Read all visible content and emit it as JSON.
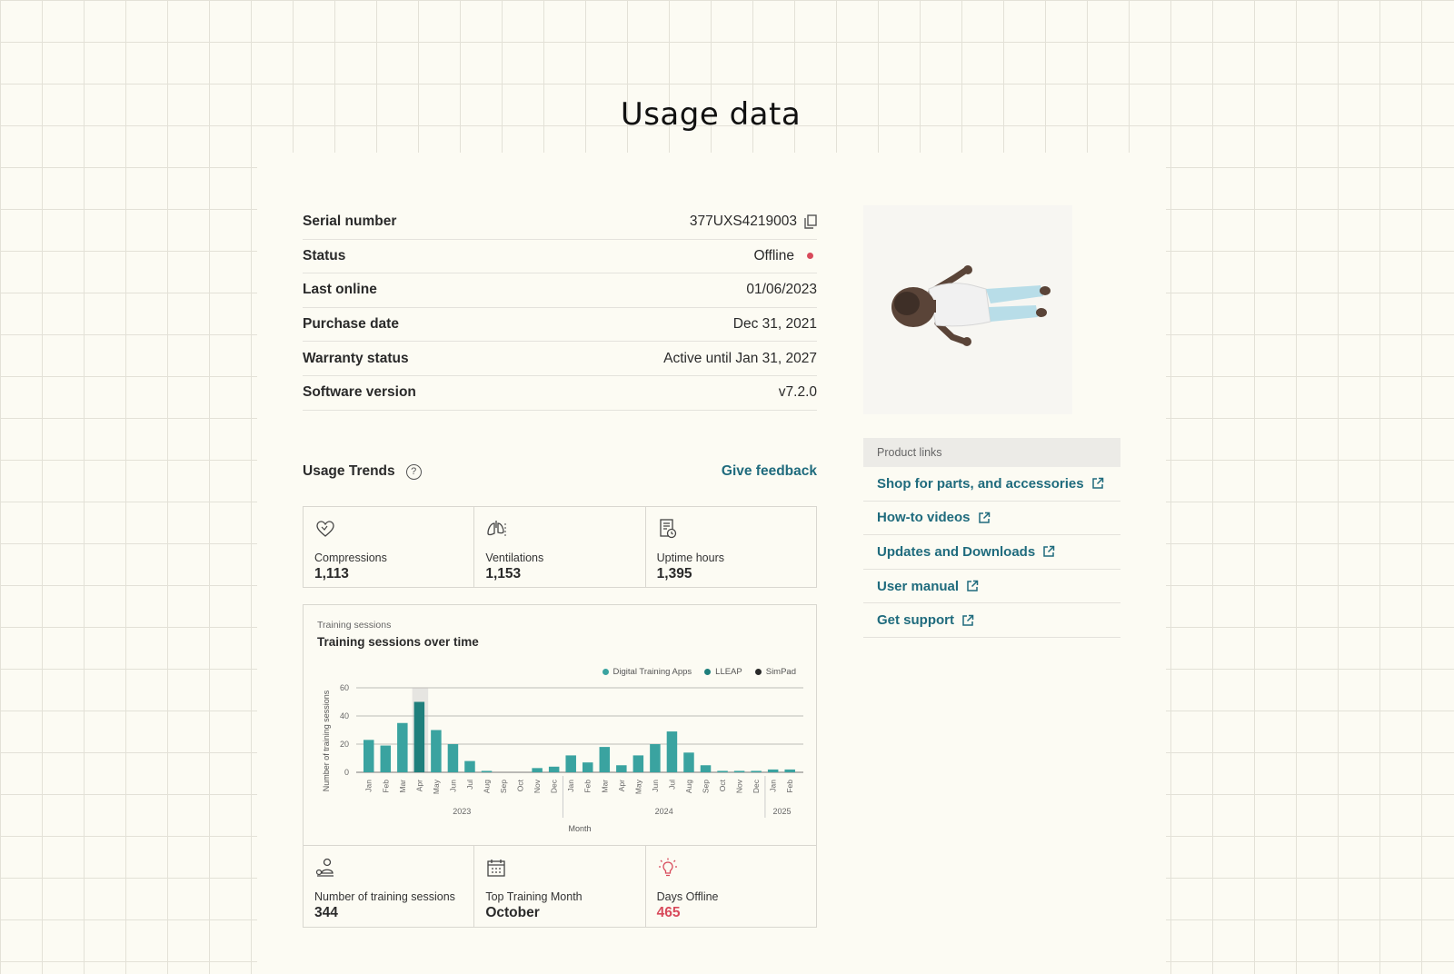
{
  "page": {
    "title": "Usage data"
  },
  "details": [
    {
      "label": "Serial number",
      "value": "377UXS4219003"
    },
    {
      "label": "Status",
      "value": "Offline"
    },
    {
      "label": "Last online",
      "value": "01/06/2023"
    },
    {
      "label": "Purchase date",
      "value": "Dec 31, 2021"
    },
    {
      "label": "Warranty status",
      "value": "Active until Jan 31, 2027"
    },
    {
      "label": "Software version",
      "value": "v7.2.0"
    }
  ],
  "product_links": {
    "header": "Product links",
    "items": [
      {
        "label": "Shop for parts, and accessories"
      },
      {
        "label": "How-to videos"
      },
      {
        "label": "Updates and Downloads"
      },
      {
        "label": "User manual"
      },
      {
        "label": "Get support"
      }
    ]
  },
  "trends": {
    "title": "Usage Trends",
    "help_icon": "?",
    "feedback_label": "Give feedback",
    "top_stats": [
      {
        "icon": "heart-icon",
        "label": "Compressions",
        "value": "1,113"
      },
      {
        "icon": "lungs-icon",
        "label": "Ventilations",
        "value": "1,153"
      },
      {
        "icon": "clock-document-icon",
        "label": "Uptime hours",
        "value": "1,395"
      }
    ],
    "bottom_stats": [
      {
        "icon": "person-location-icon",
        "label": "Number of training sessions",
        "value": "344"
      },
      {
        "icon": "calendar-icon",
        "label": "Top Training Month",
        "value": "October"
      },
      {
        "icon": "lightbulb-icon",
        "label": "Days Offline",
        "value": "465"
      }
    ]
  },
  "colors": {
    "accent": "#1f6b7d",
    "bar": "#3aa3a0",
    "bar_highlight": "#1f7f7c",
    "simpad": "#2a2a2a",
    "status_offline": "#d84a5b"
  },
  "chart_data": {
    "type": "bar",
    "kicker": "Training sessions",
    "title": "Training sessions over time",
    "xlabel": "Month",
    "ylabel": "Number of training sessions",
    "ylim": [
      0,
      60
    ],
    "yticks": [
      0,
      20,
      40,
      60
    ],
    "grid": true,
    "legend_position": "top-right",
    "legend": [
      {
        "name": "Digital Training Apps",
        "color": "#3aa3a0"
      },
      {
        "name": "LLEAP",
        "color": "#1f7f7c"
      },
      {
        "name": "SimPad",
        "color": "#2a2a2a"
      }
    ],
    "categories": [
      "Jan",
      "Feb",
      "Mar",
      "Apr",
      "May",
      "Jun",
      "Jul",
      "Aug",
      "Sep",
      "Oct",
      "Nov",
      "Dec",
      "Jan",
      "Feb",
      "Mar",
      "Apr",
      "May",
      "Jun",
      "Jul",
      "Aug",
      "Sep",
      "Oct",
      "Nov",
      "Dec",
      "Jan",
      "Feb"
    ],
    "years": [
      {
        "label": "2023",
        "start": 0,
        "end": 11
      },
      {
        "label": "2024",
        "start": 12,
        "end": 23
      },
      {
        "label": "2025",
        "start": 24,
        "end": 25
      }
    ],
    "values": [
      23,
      19,
      35,
      50,
      30,
      20,
      8,
      1,
      0,
      0,
      3,
      4,
      12,
      7,
      18,
      5,
      12,
      20,
      29,
      14,
      5,
      1,
      1,
      1,
      2,
      2,
      2
    ],
    "highlight_index": 3
  }
}
